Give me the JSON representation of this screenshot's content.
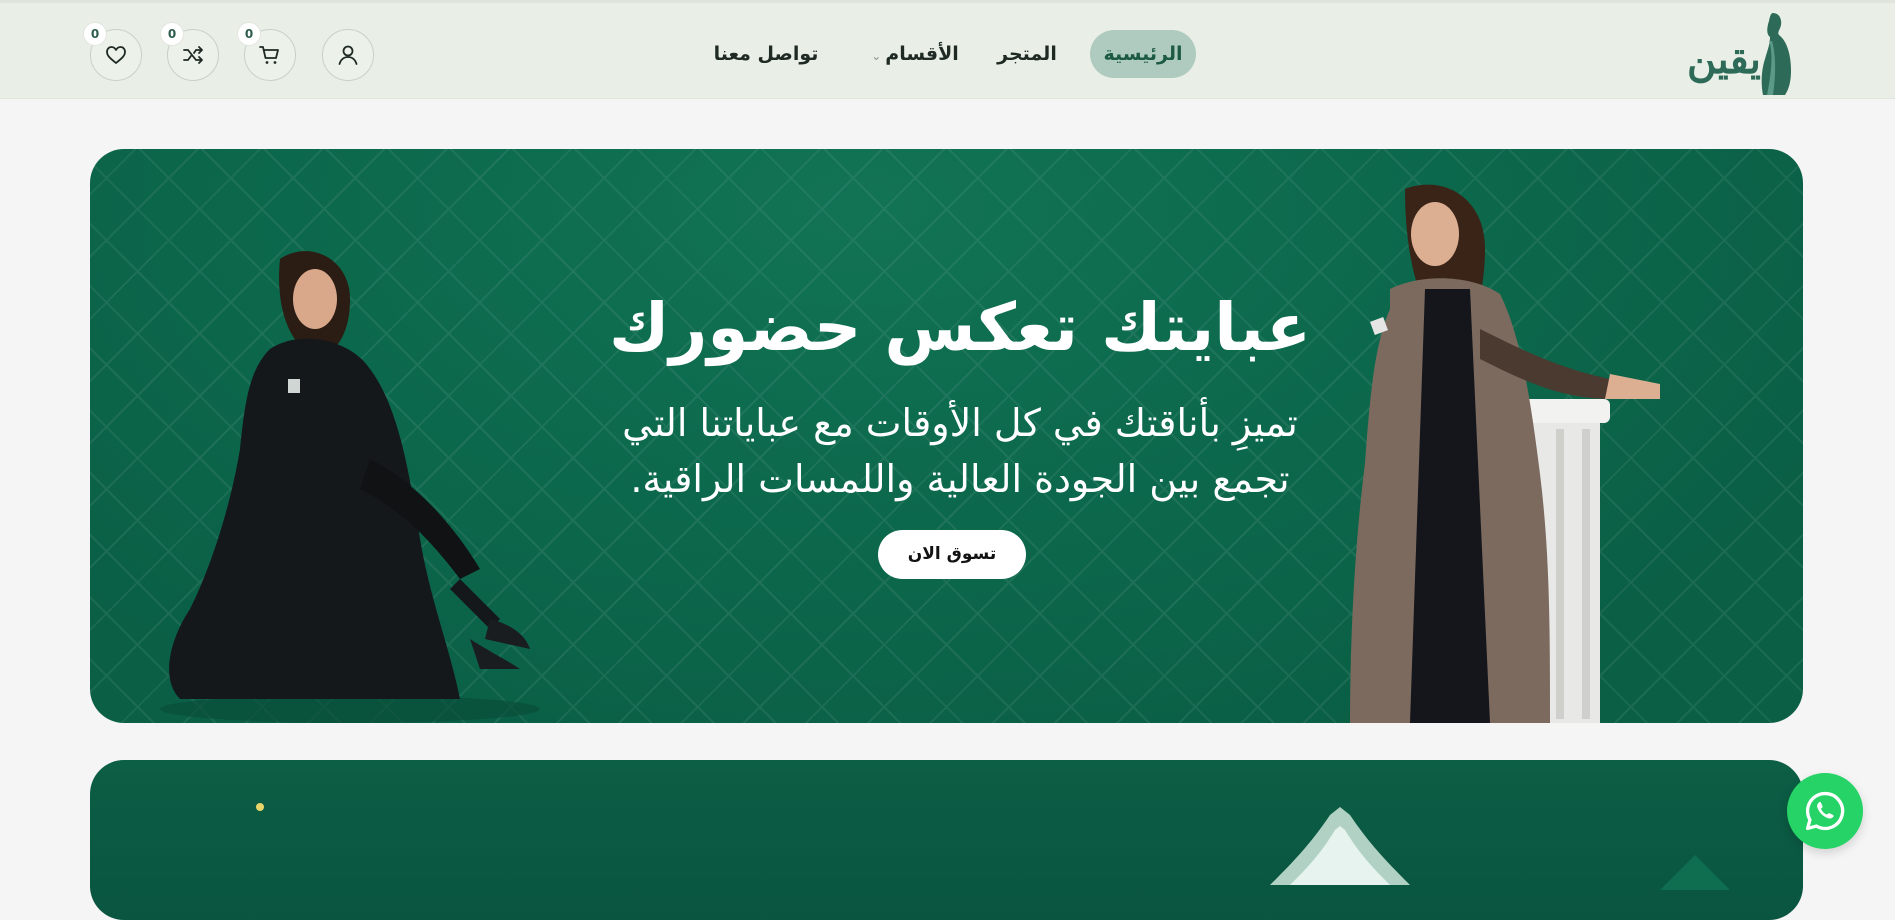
{
  "header": {
    "logo_text": "يقين",
    "nav": {
      "home": "الرئيسية",
      "store": "المتجر",
      "categories": "الأقسام",
      "contact": "تواصل معنا"
    },
    "icons": {
      "account": "user-icon",
      "cart": "cart-icon",
      "compare": "shuffle-icon",
      "wishlist": "heart-icon"
    },
    "counts": {
      "cart": "0",
      "compare": "0",
      "wishlist": "0"
    }
  },
  "hero": {
    "title": "عبايتك تعكس حضورك",
    "subtitle_line1": "تميزِ بأناقتك في كل الأوقات مع عباياتنا التي",
    "subtitle_line2": "تجمع بين الجودة العالية واللمسات الراقية.",
    "cta": "تسوق الان"
  },
  "colors": {
    "header_bg": "#e9efe6",
    "active_pill": "#afcbbf",
    "hero_green": "#0d6a4d",
    "whatsapp_green": "#25d366"
  },
  "floating": {
    "whatsapp_icon": "whatsapp-icon"
  }
}
